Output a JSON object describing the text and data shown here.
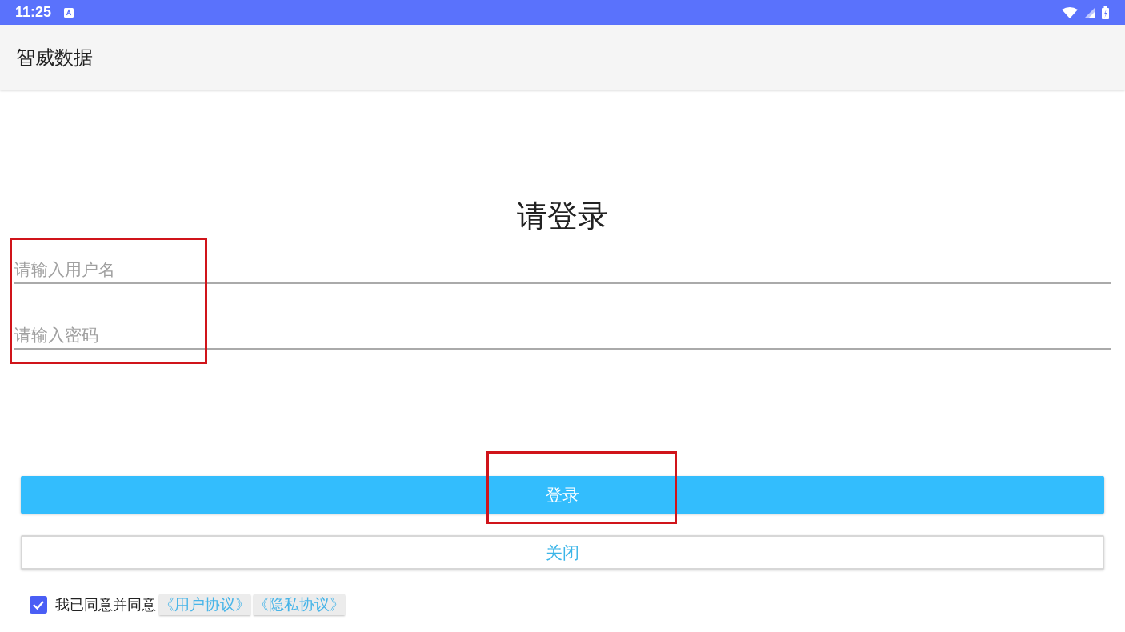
{
  "status_bar": {
    "time": "11:25"
  },
  "app_bar": {
    "title": "智威数据"
  },
  "heading": "请登录",
  "fields": [
    {
      "placeholder": "请输入用户名"
    },
    {
      "placeholder": "请输入密码"
    }
  ],
  "buttons": [
    {
      "label": "登录",
      "kind": "primary"
    },
    {
      "label": "关闭",
      "kind": "outline"
    }
  ],
  "agreement": {
    "checked": true,
    "text": "我已同意并同意",
    "links": [
      "《用户协议》",
      "《隐私协议》"
    ]
  },
  "highlights": {
    "fields_marked": true,
    "login_button_marked": true
  }
}
